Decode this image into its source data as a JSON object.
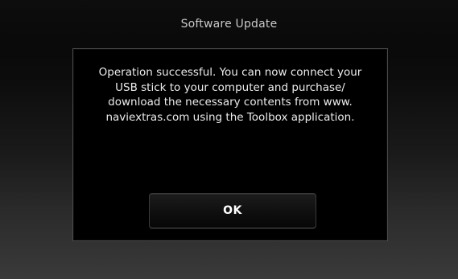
{
  "header": {
    "title": "Software Update"
  },
  "dialog": {
    "message_lines": [
      "Operation successful. You can now connect your",
      "USB stick to your computer and purchase/",
      "download the necessary contents from www.",
      "naviextras.com using the Toolbox application."
    ],
    "ok_label": "OK"
  },
  "colors": {
    "background_top": "#050505",
    "background_bottom": "#3a3a3a",
    "dialog_bg": "#000000",
    "dialog_border": "#4a4a4a",
    "title_text": "#c9c9c9",
    "message_text": "#ececec"
  }
}
